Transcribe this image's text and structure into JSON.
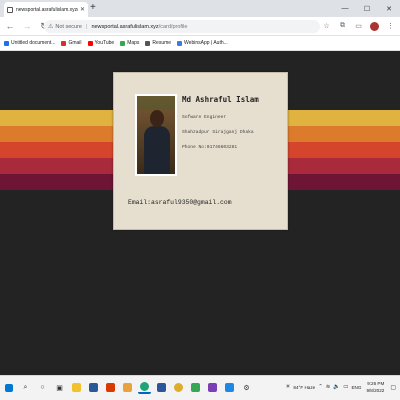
{
  "browser": {
    "tab_title": "newsportal.asrafulislam.xyz/car...",
    "new_tab_label": "+",
    "not_secure_label": "Not secure",
    "url_host": "newsportal.asrafulislam.xyz",
    "url_path": "/card/profile",
    "bookmarks": [
      {
        "label": "Untitled document...",
        "color": "#1a73e8"
      },
      {
        "label": "Gmail",
        "color": "#d93025"
      },
      {
        "label": "YouTube",
        "color": "#ff0000"
      },
      {
        "label": "Maps",
        "color": "#34a853"
      },
      {
        "label": "Resume",
        "color": "#555555"
      },
      {
        "label": "WebinsApp | Auth...",
        "color": "#3b7ddd"
      }
    ]
  },
  "profile": {
    "name": "Md Ashraful Islam",
    "role": "Sofware Engineer",
    "address": "Shahzadpur Sirajganj Dhaka",
    "phone": "Phone No:01746603281",
    "email": "Email:asraful9350@gmail.com"
  },
  "stripe_colors": [
    "#e0b23f",
    "#dd7b2c",
    "#d4452c",
    "#a92a3a",
    "#6e1435"
  ],
  "taskbar": {
    "weather": "84°F Haze",
    "language": "ENG",
    "time": "9:26 PM",
    "date": "9/8/2022"
  }
}
